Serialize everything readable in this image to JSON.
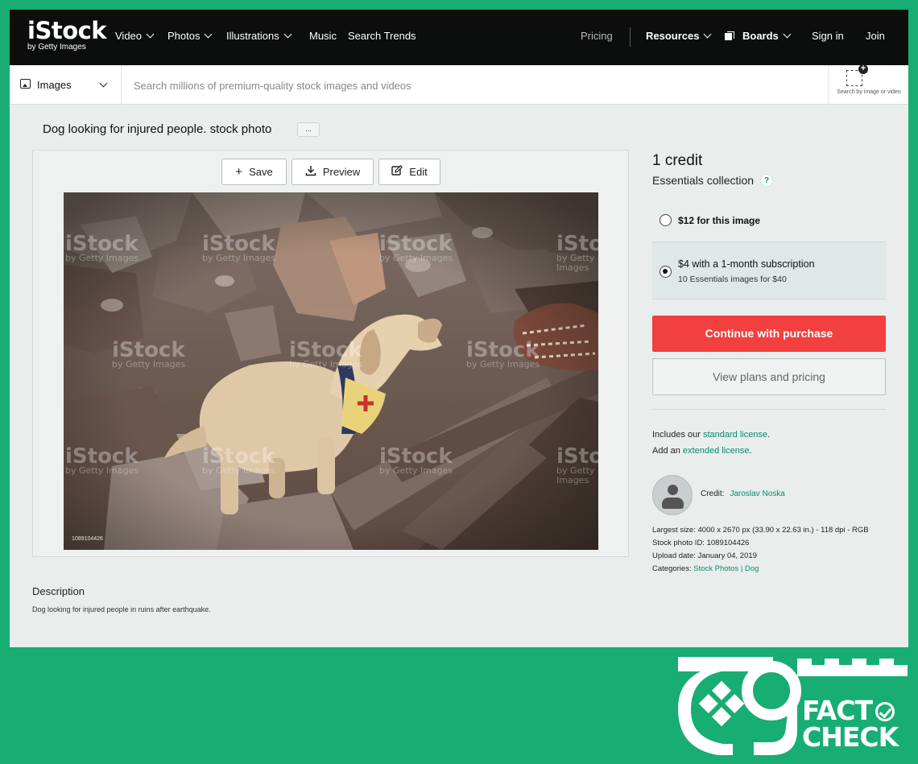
{
  "header": {
    "logo_main": "iStock",
    "logo_sub": "by Getty Images",
    "nav": [
      {
        "label": "Video",
        "dropdown": true
      },
      {
        "label": "Photos",
        "dropdown": true
      },
      {
        "label": "Illustrations",
        "dropdown": true
      },
      {
        "label": "Music",
        "dropdown": false
      },
      {
        "label": "Search Trends",
        "dropdown": false
      }
    ],
    "pricing": "Pricing",
    "resources": "Resources",
    "boards": "Boards",
    "sign_in": "Sign in",
    "join": "Join"
  },
  "search": {
    "media_type": "Images",
    "placeholder": "Search millions of premium-quality stock images and videos",
    "value": "",
    "search_by_image": "Search by image or video"
  },
  "asset": {
    "title": "Dog looking for injured people. stock photo",
    "more_label": "...",
    "toolbar": {
      "save": "Save",
      "preview": "Preview",
      "edit": "Edit"
    },
    "watermark_main": "iStock",
    "watermark_sub": "by Getty Images",
    "photo_id_overlay": "1089104426",
    "description_heading": "Description",
    "description": "Dog looking for injured people in ruins after earthquake."
  },
  "purchase": {
    "credit": "1 credit",
    "collection": "Essentials collection",
    "help": "?",
    "option1": "$12 for this image",
    "option2": "$4 with a 1-month subscription",
    "option2_sub": "10 Essentials images for $40",
    "selected_option": 2,
    "continue": "Continue with purchase",
    "plans": "View plans and pricing"
  },
  "license": {
    "includes_prefix": "Includes our ",
    "standard": "standard license",
    "includes_suffix": ".",
    "add_prefix": "Add an ",
    "extended": "extended license",
    "add_suffix": "."
  },
  "details": {
    "credit_label": "Credit:",
    "credit_name": "Jaroslav Noska",
    "largest_size_label": "Largest size:",
    "largest_size": "4000 x 2670 px (33.90 x 22.63 in.) - 118 dpi - RGB",
    "stock_id_label": "Stock photo ID:",
    "stock_id": "1089104426",
    "upload_date_label": "Upload date:",
    "upload_date": "January 04, 2019",
    "categories_label": "Categories:",
    "category1": "Stock Photos",
    "category_sep": " | ",
    "category2": "Dog"
  },
  "badge": {
    "line1": "FACT",
    "line2": "CHECK"
  },
  "colors": {
    "frame_green": "#17ad73",
    "cta_red": "#f23f3f",
    "link_teal": "#0a8a6a",
    "nav_black": "#0c0d0d"
  }
}
